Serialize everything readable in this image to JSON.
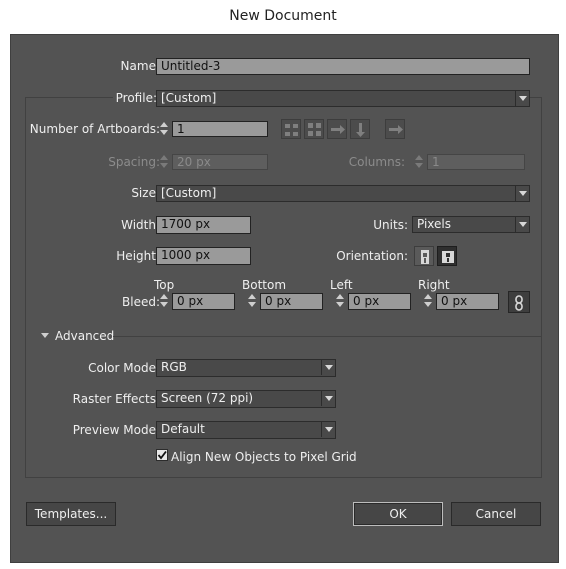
{
  "window": {
    "title": "New Document"
  },
  "name": {
    "label": "Name:",
    "value": "Untitled-3"
  },
  "profile": {
    "label": "Profile:",
    "value": "[Custom]"
  },
  "artboards": {
    "label": "Number of Artboards:",
    "value": "1"
  },
  "spacing": {
    "label": "Spacing:",
    "value": "20 px"
  },
  "columns": {
    "label": "Columns:",
    "value": "1"
  },
  "size": {
    "label": "Size:",
    "value": "[Custom]"
  },
  "width": {
    "label": "Width:",
    "value": "1700 px"
  },
  "height": {
    "label": "Height:",
    "value": "1000 px"
  },
  "units": {
    "label": "Units:",
    "value": "Pixels"
  },
  "orientation": {
    "label": "Orientation:",
    "icons": [
      "portrait-icon",
      "landscape-icon"
    ]
  },
  "bleed": {
    "label": "Bleed:",
    "top_label": "Top",
    "top_value": "0 px",
    "bottom_label": "Bottom",
    "bottom_value": "0 px",
    "left_label": "Left",
    "left_value": "0 px",
    "right_label": "Right",
    "right_value": "0 px"
  },
  "advanced": {
    "label": "Advanced",
    "color_mode": {
      "label": "Color Mode:",
      "value": "RGB"
    },
    "raster_effects": {
      "label": "Raster Effects:",
      "value": "Screen (72 ppi)"
    },
    "preview_mode": {
      "label": "Preview Mode:",
      "value": "Default"
    },
    "align_pixel_grid": {
      "label": "Align New Objects to Pixel Grid",
      "checked": true
    }
  },
  "buttons": {
    "templates": "Templates...",
    "ok": "OK",
    "cancel": "Cancel"
  },
  "colors": {
    "panel": "#535353",
    "field": "#e9e9e9",
    "dropdown": "#494949"
  }
}
